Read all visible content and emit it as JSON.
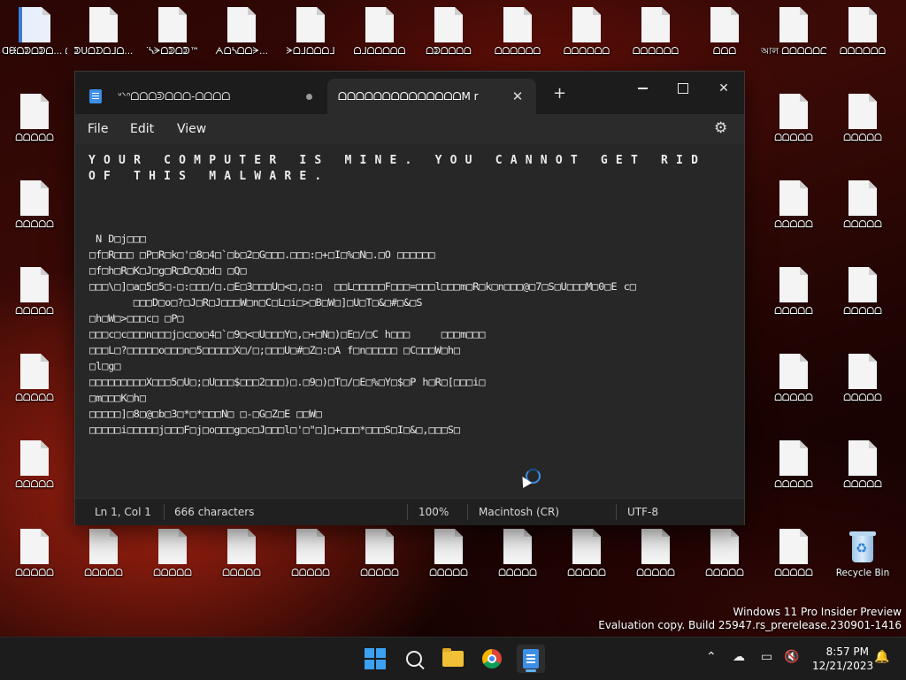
{
  "desktop": {
    "icons_top": [
      "ᗡᙠᗝᕲᗝᕲᗝ... ᗝᒧᗝᕲᗝᕲᗝ",
      "ᕲᑌᗝᗤᗝᒧᗝ...",
      "ᐝᓴᗒᗝᕲᗝᕲ™",
      "ᗅᗝᓴᗝᗝᗒ...",
      "ᗒᗝᒧᗝᗝᗝᒧ",
      "ᗝᒧᗝᗝᗝᗝᗝ",
      "ᗝᕲᗝᗝᗝᗝ",
      "ᗝᗝᗝᗝᗝᗝ",
      "ᗝᗝᗝᗝᗝᗝ",
      "ᗝᗝᗝᗝᗝᗝ",
      "ᗝᗝᗝ",
      "আল ᗝᗝᗝᗝᗝᗝ",
      "ᗝᗝᗝᗝᗝᗝ"
    ],
    "icons_left": [
      "ᗝᗝᗝᗝᗝ",
      "ᗝᗝᗝᗝᗝ",
      "ᗝᗝᗝᗝᗝ",
      "ᗝᗝᗝᗝᗝ",
      "ᗝᗝᗝᗝᗝ"
    ],
    "icons_right_a": [
      "ᗝᗝᗝᗝᗝ",
      "ᗝᗝᗝᗝᗝ",
      "ᗝᗝᗝᗝᗝ",
      "ᗝᗝᗝᗝᗝ",
      "ᗝᗝᗝᗝᗝ"
    ],
    "icons_right_b": [
      "ᗝᗝᗝᗝᗝ",
      "ᗝᗝᗝᗝᗝ",
      "ᗝᗝᗝᗝᗝ",
      "ᗝᗝᗝᗝᗝ",
      "ᗝᗝᗝᗝᗝ"
    ],
    "icons_bottom": [
      "ᗝᗝᗝᗝᗝ",
      "ᗝᗝᗝᗝᗝ",
      "ᗝᗝᗝᗝᗝ",
      "ᗝᗝᗝᗝᗝ",
      "ᗝᗝᗝᗝᗝ",
      "ᗝᗝᗝᗝᗝ",
      "ᗝᗝᗝᗝᗝ",
      "ᗝᗝᗝᗝᗝ",
      "ᗝᗝᗝᗝᗝ",
      "ᗝᗝᗝᗝᗝ",
      "ᗝᗝᗝᗝᗝ",
      "ᗝᗝᗝᗝᗝ"
    ],
    "recycle_bin_label": "Recycle Bin",
    "watermark_line1": "Windows 11 Pro Insider Preview",
    "watermark_line2": "Evaluation copy. Build 25947.rs_prerelease.230901-1416"
  },
  "notepad": {
    "tabs": [
      {
        "title": "ᐡᐠᐢᗝᗝᗝᕲᗝᗝᗝ-ᗝᗝᗝᗝ",
        "unsaved": true
      },
      {
        "title": "ᗝᗝᗝᗝᗝᗝᗝᗝᗝᗝᗝᗝᗝᗝM r"
      }
    ],
    "menu": {
      "file": "File",
      "edit": "Edit",
      "view": "View"
    },
    "headline": "YOUR COMPUTER IS MINE. YOU CANNOT GET RID OF THIS MALWARE.",
    "garbled_lines": [
      " N D□j□□□",
      "□f□R□□□ □P□R□k□'□8□4□`□b□2□G□□□.□□□:□+□I□%□N□.□O □□□□□□",
      "□f□h□R□K□J□g□R□D□Q□d□ □Q□",
      "□□□\\□]□a□5□5□-□:□□□/□.□E□3□□□U□<□,□:□  □□L□□□□□F□□□=□□□l□□□m□R□k□n□□□@□7□S□U□□□M□0□E c□",
      "       □□□D□o□?□J□R□J□□□W□n□C□L□i□>□B□W□]□U□T□&□#□&□S",
      "□h□W□>□□□c□ □P□",
      "□□□c□c□□□n□□□j□c□o□4□`□9□<□U□□□Y□,□+□N□)□E□/□C h□□□     □□□m□□□",
      "□□□L□?□□□□□o□□□n□5□□□□□X□/□;□□□U□#□Z□:□A f□n□□□□□ □C□□□W□h□",
      "□l□g□",
      "□□□□□□□□□X□□□5□U□;□U□□□$□□□2□□□)□.□9□)□T□/□E□%□Y□$□P h□R□[□□□i□",
      "□m□□□K□h□",
      "□□□□□]□8□@□b□3□*□*□□□N□ □-□G□Z□E □□W□",
      "□□□□□i□□□□□j□□□F□j□o□□□g□c□J□□□l□'□\"□]□+□□□*□□□S□I□&□,□□□S□"
    ],
    "status": {
      "position": "Ln 1, Col 1",
      "characters": "666 characters",
      "zoom": "100%",
      "line_endings": "Macintosh (CR)",
      "encoding": "UTF-8"
    }
  },
  "taskbar": {
    "clock_time": "8:57 PM",
    "clock_date": "12/21/2023"
  }
}
